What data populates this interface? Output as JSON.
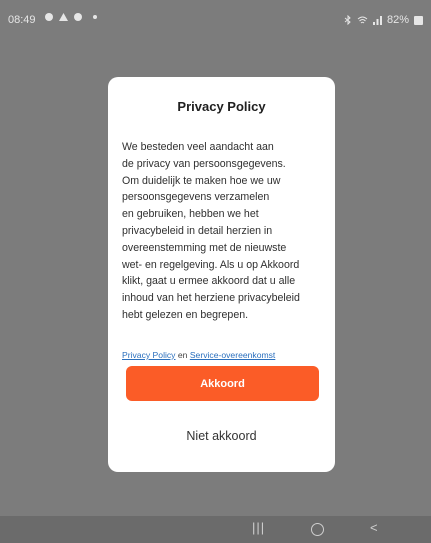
{
  "status_bar": {
    "time": "08:49",
    "right_text": "82%"
  },
  "dialog": {
    "title": "Privacy Policy",
    "body_lines": [
      "We besteden veel aandacht aan",
      "de privacy van persoonsgegevens.",
      "Om duidelijk te maken hoe we uw",
      "persoonsgegevens verzamelen",
      "en gebruiken, hebben we het",
      "privacybeleid in detail herzien in",
      "overeenstemming met de nieuwste",
      "wet- en regelgeving. Als u op Akkoord",
      "klikt, gaat u ermee akkoord dat u alle",
      "inhoud van het herziene privacybeleid",
      "hebt gelezen en begrepen."
    ],
    "link_privacy": "Privacy Policy",
    "link_conj": "en",
    "link_service": "Service-overeenkomst",
    "agree_label": "Akkoord",
    "disagree_label": "Niet akkoord"
  },
  "nav": {
    "recent_glyph": "|||",
    "back_glyph": "<"
  }
}
